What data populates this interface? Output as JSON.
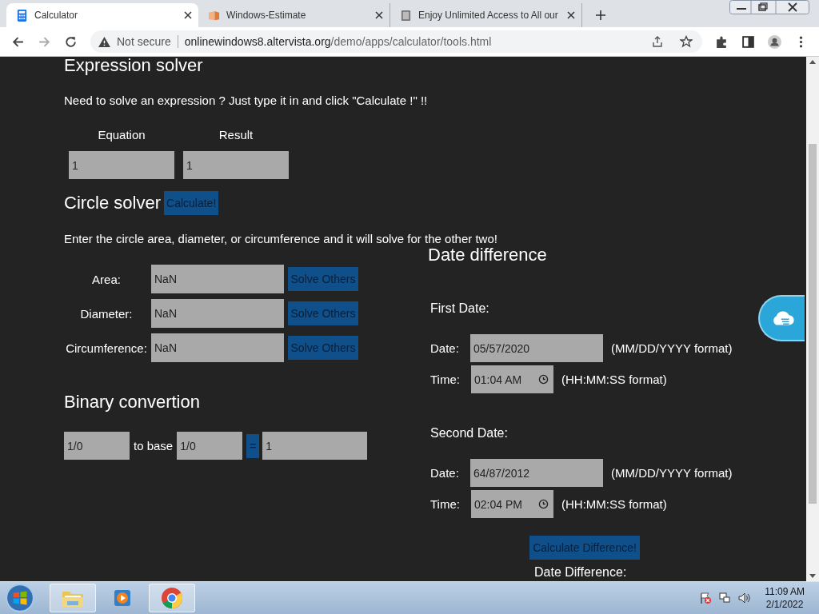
{
  "browser": {
    "tabs": [
      {
        "title": "Calculator",
        "kind": "calculator",
        "selected": true
      },
      {
        "title": "Windows-Estimate",
        "kind": "estimate",
        "selected": false
      },
      {
        "title": "Enjoy Unlimited Access to All our",
        "kind": "book",
        "selected": false
      }
    ],
    "security": "Not secure",
    "url_host": "onlinewindows8.altervista.org",
    "url_path": "/demo/apps/calculator/tools.html"
  },
  "expression_solver": {
    "title": "Expression solver",
    "instructions": "Need to solve an expression ? Just type it in and click \"Calculate !\" !!",
    "columns": [
      "Equation",
      "Result"
    ],
    "equation": "1",
    "result": "1",
    "button": "Calculate!"
  },
  "circle_solver": {
    "title": "Circle solver",
    "instructions": "Enter the circle area, diameter, or circumference and it will solve for the other two!",
    "rows": [
      {
        "label": "Area:",
        "value": "NaN",
        "button": "Solve Others"
      },
      {
        "label": "Diameter:",
        "value": "NaN",
        "button": "Solve Others"
      },
      {
        "label": "Circumference:",
        "value": "NaN",
        "button": "Solve Others"
      }
    ]
  },
  "binary_convertion": {
    "title": "Binary convertion",
    "value": "1/0",
    "to_label": "to base",
    "base": "1/0",
    "button": "=",
    "result": "1"
  },
  "date_difference": {
    "title": "Date difference",
    "dates": [
      {
        "heading": "First Date:",
        "date_label": "Date:",
        "date": "05/57/2020",
        "date_hint": "(MM/DD/YYYY format)",
        "time_label": "Time:",
        "time": "01:04 AM",
        "time_hint": "(HH:MM:SS format)"
      },
      {
        "heading": "Second Date:",
        "date_label": "Date:",
        "date": "64/87/2012",
        "date_hint": "(MM/DD/YYYY format)",
        "time_label": "Time:",
        "time": "02:04 PM",
        "time_hint": "(HH:MM:SS format)"
      }
    ],
    "button": "Calculate Difference!",
    "result_heading": "Date Difference:"
  },
  "taskbar": {
    "apps": [
      {
        "kind": "explorer",
        "highlighted": true
      },
      {
        "kind": "media",
        "highlighted": false
      },
      {
        "kind": "chrome",
        "highlighted": true
      }
    ],
    "time": "11:09 AM",
    "date": "2/1/2022"
  }
}
